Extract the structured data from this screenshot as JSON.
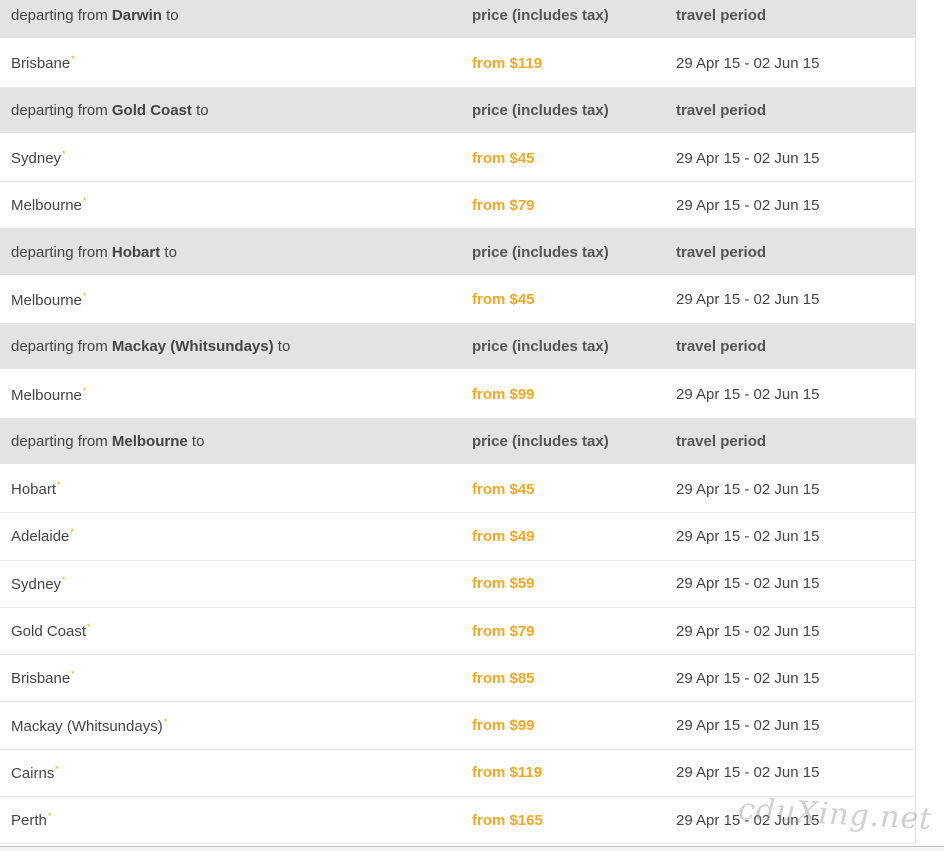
{
  "labels": {
    "departing_prefix": "departing from ",
    "departing_suffix": " to",
    "price_header": "price (includes tax)",
    "period_header": "travel period",
    "asterisk": "*"
  },
  "groups": [
    {
      "origin": "Darwin",
      "routes": [
        {
          "destination": "Brisbane",
          "price": "from $119",
          "period": "29 Apr 15 - 02 Jun 15"
        }
      ]
    },
    {
      "origin": "Gold Coast",
      "routes": [
        {
          "destination": "Sydney",
          "price": "from $45",
          "period": "29 Apr 15 - 02 Jun 15"
        },
        {
          "destination": "Melbourne",
          "price": "from $79",
          "period": "29 Apr 15 - 02 Jun 15"
        }
      ]
    },
    {
      "origin": "Hobart",
      "routes": [
        {
          "destination": "Melbourne",
          "price": "from $45",
          "period": "29 Apr 15 - 02 Jun 15"
        }
      ]
    },
    {
      "origin": "Mackay (Whitsundays)",
      "routes": [
        {
          "destination": "Melbourne",
          "price": "from $99",
          "period": "29 Apr 15 - 02 Jun 15"
        }
      ]
    },
    {
      "origin": "Melbourne",
      "routes": [
        {
          "destination": "Hobart",
          "price": "from $45",
          "period": "29 Apr 15 - 02 Jun 15"
        },
        {
          "destination": "Adelaide",
          "price": "from $49",
          "period": "29 Apr 15 - 02 Jun 15"
        },
        {
          "destination": "Sydney",
          "price": "from $59",
          "period": "29 Apr 15 - 02 Jun 15"
        },
        {
          "destination": "Gold Coast",
          "price": "from $79",
          "period": "29 Apr 15 - 02 Jun 15"
        },
        {
          "destination": "Brisbane",
          "price": "from $85",
          "period": "29 Apr 15 - 02 Jun 15"
        },
        {
          "destination": "Mackay (Whitsundays)",
          "price": "from $99",
          "period": "29 Apr 15 - 02 Jun 15"
        },
        {
          "destination": "Cairns",
          "price": "from $119",
          "period": "29 Apr 15 - 02 Jun 15"
        },
        {
          "destination": "Perth",
          "price": "from $165",
          "period": "29 Apr 15 - 02 Jun 15"
        }
      ]
    }
  ],
  "watermark": "cduXing.net",
  "colors": {
    "price": "#f5a623",
    "header_bg": "#e3e3e3",
    "text": "#444444"
  }
}
